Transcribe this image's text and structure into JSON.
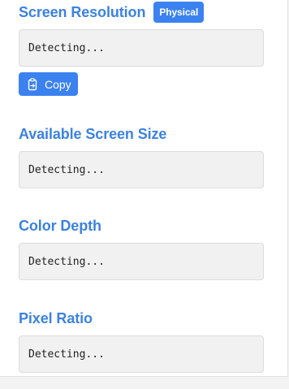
{
  "sections": [
    {
      "title": "Screen Resolution",
      "badge": "Physical",
      "value": "Detecting...",
      "copy_label": "Copy"
    },
    {
      "title": "Available Screen Size",
      "value": "Detecting..."
    },
    {
      "title": "Color Depth",
      "value": "Detecting..."
    },
    {
      "title": "Pixel Ratio",
      "value": "Detecting..."
    }
  ],
  "colors": {
    "accent": "#3b82f0",
    "title": "#3b82e0",
    "value_bg": "#f1f1f1"
  },
  "icons": {
    "copy": "clipboard-copy-icon"
  }
}
